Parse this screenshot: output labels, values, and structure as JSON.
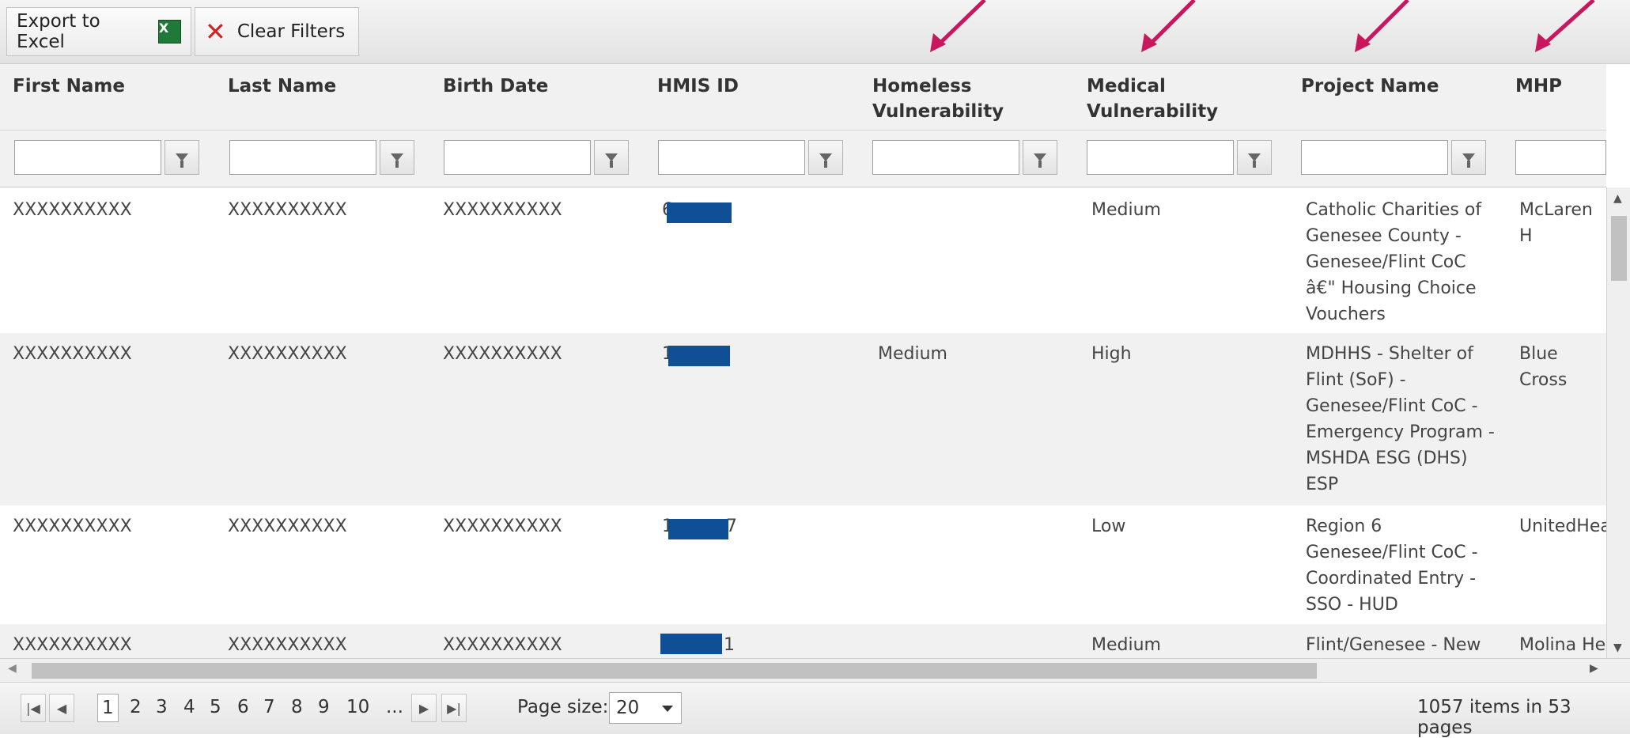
{
  "toolbar": {
    "export_label": "Export to Excel",
    "excel_icon": "excel-icon",
    "clear_label": "Clear Filters",
    "clear_icon": "red-x-icon"
  },
  "columns": [
    "First Name",
    "Last Name",
    "Birth Date",
    "HMIS ID",
    "Homeless Vulnerability",
    "Medical Vulnerability",
    "Project Name",
    "MHP"
  ],
  "rows": [
    {
      "first": "XXXXXXXXXX",
      "last": "XXXXXXXXXX",
      "birth": "XXXXXXXXXX",
      "hmis": "6",
      "homeless": "",
      "medical": "Medium",
      "project": [
        "Catholic Charities of",
        "Genesee County -",
        "Genesee/Flint CoC",
        "â€\" Housing Choice",
        "Vouchers"
      ],
      "mhp": "McLaren H"
    },
    {
      "first": "XXXXXXXXXX",
      "last": "XXXXXXXXXX",
      "birth": "XXXXXXXXXX",
      "hmis": "1",
      "homeless": "Medium",
      "medical": "High",
      "project": [
        "MDHHS - Shelter of",
        "Flint (SoF) -",
        "Genesee/Flint CoC -",
        "Emergency Program -",
        "MSHDA ESG (DHS)",
        "ESP"
      ],
      "mhp": "Blue Cross"
    },
    {
      "first": "XXXXXXXXXX",
      "last": "XXXXXXXXXX",
      "birth": "XXXXXXXXXX",
      "hmis": "1 7",
      "homeless": "",
      "medical": "Low",
      "project": [
        "Region 6",
        "Genesee/Flint CoC -",
        "Coordinated Entry -",
        "SSO - HUD"
      ],
      "mhp": "UnitedHea"
    },
    {
      "first": "XXXXXXXXXX",
      "last": "XXXXXXXXXX",
      "birth": "XXXXXXXXXX",
      "hmis": "1",
      "homeless": "",
      "medical": "Medium",
      "project": [
        "Flint/Genesee - New"
      ],
      "mhp": "Molina He"
    }
  ],
  "pager": {
    "pages": [
      "1",
      "2",
      "3",
      "4",
      "5",
      "6",
      "7",
      "8",
      "9",
      "10",
      "..."
    ],
    "current": "1",
    "page_size_label": "Page size:",
    "page_size_value": "20",
    "summary": "1057 items in 53 pages"
  },
  "colors": {
    "annotation_arrow": "#c8175d",
    "redaction": "#0f4f96",
    "alt_row": "#f1f1f1"
  }
}
